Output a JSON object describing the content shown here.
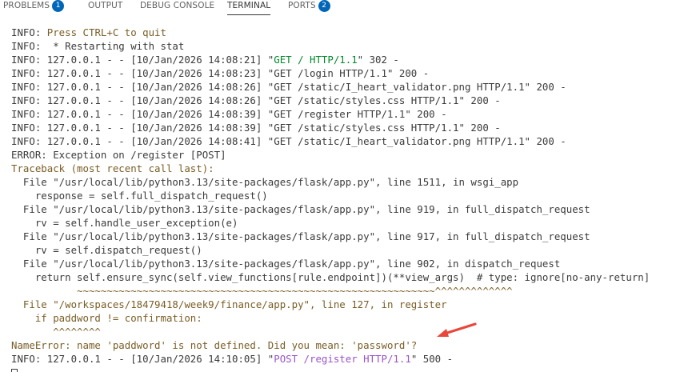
{
  "tabs": [
    {
      "label": "PROBLEMS",
      "badge": "1",
      "active": false
    },
    {
      "label": "OUTPUT",
      "badge": null,
      "active": false
    },
    {
      "label": "DEBUG CONSOLE",
      "badge": null,
      "active": false
    },
    {
      "label": "TERMINAL",
      "badge": null,
      "active": true
    },
    {
      "label": "PORTS",
      "badge": "2",
      "active": false
    }
  ],
  "colors": {
    "badge": "#0066b8",
    "text": "#3b3b3b",
    "brown": "#795e26",
    "green": "#00892a",
    "purple": "#9b54c9",
    "arrow": "#e8473a"
  },
  "terminal": {
    "lines": [
      [
        {
          "t": "INFO: ",
          "c": "default"
        },
        {
          "t": "Press CTRL+C to quit",
          "c": "brown"
        }
      ],
      [
        {
          "t": "INFO:  * Restarting with stat",
          "c": "default"
        }
      ],
      [
        {
          "t": "INFO: 127.0.0.1 - - [10/Jan/2026 14:08:21] \"",
          "c": "default"
        },
        {
          "t": "GET / HTTP/1.1",
          "c": "green"
        },
        {
          "t": "\" 302 -",
          "c": "default"
        }
      ],
      [
        {
          "t": "INFO: 127.0.0.1 - - [10/Jan/2026 14:08:23] \"GET /login HTTP/1.1\" 200 -",
          "c": "default"
        }
      ],
      [
        {
          "t": "INFO: 127.0.0.1 - - [10/Jan/2026 14:08:26] \"GET /static/I_heart_validator.png HTTP/1.1\" 200 -",
          "c": "default"
        }
      ],
      [
        {
          "t": "INFO: 127.0.0.1 - - [10/Jan/2026 14:08:26] \"GET /static/styles.css HTTP/1.1\" 200 -",
          "c": "default"
        }
      ],
      [
        {
          "t": "INFO: 127.0.0.1 - - [10/Jan/2026 14:08:39] \"GET /register HTTP/1.1\" 200 -",
          "c": "default"
        }
      ],
      [
        {
          "t": "INFO: 127.0.0.1 - - [10/Jan/2026 14:08:39] \"GET /static/styles.css HTTP/1.1\" 200 -",
          "c": "default"
        }
      ],
      [
        {
          "t": "INFO: 127.0.0.1 - - [10/Jan/2026 14:08:41] \"GET /static/I_heart_validator.png HTTP/1.1\" 200 -",
          "c": "default"
        }
      ],
      [
        {
          "t": "ERROR: Exception on /register [POST]",
          "c": "default"
        }
      ],
      [
        {
          "t": "Traceback (most recent call last):",
          "c": "brown"
        }
      ],
      [
        {
          "t": "  File \"/usr/local/lib/python3.13/site-packages/flask/app.py\", line 1511, in wsgi_app",
          "c": "default"
        }
      ],
      [
        {
          "t": "    response = self.full_dispatch_request()",
          "c": "default"
        }
      ],
      [
        {
          "t": "  File \"/usr/local/lib/python3.13/site-packages/flask/app.py\", line 919, in full_dispatch_request",
          "c": "default"
        }
      ],
      [
        {
          "t": "    rv = self.handle_user_exception(e)",
          "c": "default"
        }
      ],
      [
        {
          "t": "  File \"/usr/local/lib/python3.13/site-packages/flask/app.py\", line 917, in full_dispatch_request",
          "c": "default"
        }
      ],
      [
        {
          "t": "    rv = self.dispatch_request()",
          "c": "default"
        }
      ],
      [
        {
          "t": "  File \"/usr/local/lib/python3.13/site-packages/flask/app.py\", line 902, in dispatch_request",
          "c": "default"
        }
      ],
      [
        {
          "t": "    return self.ensure_sync(self.view_functions[rule.endpoint])(**view_args)  # type: ignore[no-any-return]",
          "c": "default"
        }
      ],
      [
        {
          "t": "           ~~~~~~~~~~~~~~~~~~~~~~~~~~~~~~~~~~~~~~~~~~~~~~~~~~~~~~~~~~~~^^^^^^^^^^^^^",
          "c": "brown"
        }
      ],
      [
        {
          "t": "  File \"/workspaces/18479418/week9/finance/app.py\", line 127, in register",
          "c": "brown"
        }
      ],
      [
        {
          "t": "    if paddword != confirmation:",
          "c": "brown"
        }
      ],
      [
        {
          "t": "       ^^^^^^^^",
          "c": "brown"
        }
      ],
      [
        {
          "t": "NameError: name 'paddword' is not defined. Did you mean: 'password'?",
          "c": "brown"
        }
      ],
      [
        {
          "t": "INFO: 127.0.0.1 - - [10/Jan/2026 14:10:05] \"",
          "c": "default"
        },
        {
          "t": "POST /register HTTP/1.1",
          "c": "purple"
        },
        {
          "t": "\" 500 -",
          "c": "default"
        }
      ]
    ]
  }
}
